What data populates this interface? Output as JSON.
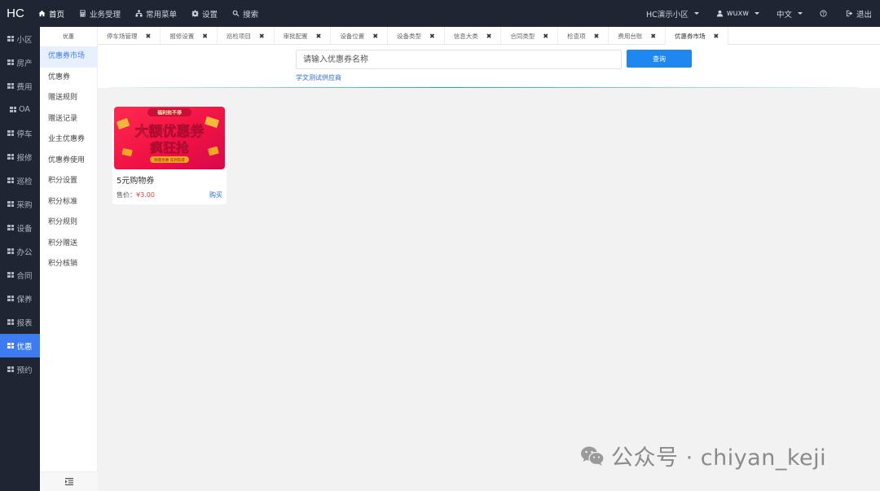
{
  "app": {
    "logo": "HC"
  },
  "topnav": {
    "items": [
      {
        "label": "首页",
        "icon": "home-icon",
        "active": true
      },
      {
        "label": "业务受理",
        "icon": "calculator-icon",
        "active": false
      },
      {
        "label": "常用菜单",
        "icon": "sitemap-icon",
        "active": false
      },
      {
        "label": "设置",
        "icon": "gear-icon",
        "active": false
      },
      {
        "label": "搜索",
        "icon": "search-icon",
        "active": false
      }
    ],
    "community": "HC演示小区",
    "user": "wuxw",
    "language": "中文",
    "help_icon": "question-circle-icon",
    "logout": "退出"
  },
  "sidebar": {
    "items": [
      {
        "label": "小区",
        "active": false
      },
      {
        "label": "房产",
        "active": false
      },
      {
        "label": "费用",
        "active": false
      },
      {
        "label": "OA",
        "active": false
      },
      {
        "label": "停车",
        "active": false
      },
      {
        "label": "报修",
        "active": false
      },
      {
        "label": "巡检",
        "active": false
      },
      {
        "label": "采购",
        "active": false
      },
      {
        "label": "设备",
        "active": false
      },
      {
        "label": "办公",
        "active": false
      },
      {
        "label": "合同",
        "active": false
      },
      {
        "label": "保养",
        "active": false
      },
      {
        "label": "报表",
        "active": false
      },
      {
        "label": "优惠",
        "active": true
      },
      {
        "label": "预约",
        "active": false
      }
    ]
  },
  "submenu": {
    "title": "优惠",
    "items": [
      {
        "label": "优惠券市场",
        "active": true
      },
      {
        "label": "优惠券",
        "active": false
      },
      {
        "label": "赠送规则",
        "active": false
      },
      {
        "label": "赠送记录",
        "active": false
      },
      {
        "label": "业主优惠券",
        "active": false
      },
      {
        "label": "优惠券使用",
        "active": false
      },
      {
        "label": "积分设置",
        "active": false
      },
      {
        "label": "积分标准",
        "active": false
      },
      {
        "label": "积分规则",
        "active": false
      },
      {
        "label": "积分赠送",
        "active": false
      },
      {
        "label": "积分核销",
        "active": false
      }
    ],
    "footer_icon": "list-indent-icon"
  },
  "tabs": [
    {
      "label": "停车场管理",
      "active": false
    },
    {
      "label": "报修设置",
      "active": false
    },
    {
      "label": "巡检项目",
      "active": false
    },
    {
      "label": "审批配置",
      "active": false
    },
    {
      "label": "设备位置",
      "active": false
    },
    {
      "label": "设备类型",
      "active": false
    },
    {
      "label": "信息大类",
      "active": false
    },
    {
      "label": "合同类型",
      "active": false
    },
    {
      "label": "检查项",
      "active": false
    },
    {
      "label": "费用台账",
      "active": false
    },
    {
      "label": "优惠券市场",
      "active": true
    }
  ],
  "search": {
    "placeholder": "请输入优惠券名称",
    "value": "",
    "button": "查询",
    "supplier": "学文测试供应商"
  },
  "coupons": [
    {
      "name": "5元购物券",
      "price_label": "售价：",
      "price": "¥3.00",
      "buy": "购买",
      "banner": {
        "top_badge": "福利抢不停",
        "line1": "大额优惠券",
        "line2": "疯狂抢",
        "footer": "限量优惠 先到先得"
      }
    }
  ],
  "watermark": {
    "text": "公众号 · chiyan_keji",
    "icon": "wechat-icon"
  },
  "colors": {
    "nav_bg": "#1f2533",
    "active_blue": "#3d7cf0",
    "button_blue": "#1e88f0",
    "divider_green": "#1ab394",
    "price_red": "#e43b3b"
  }
}
